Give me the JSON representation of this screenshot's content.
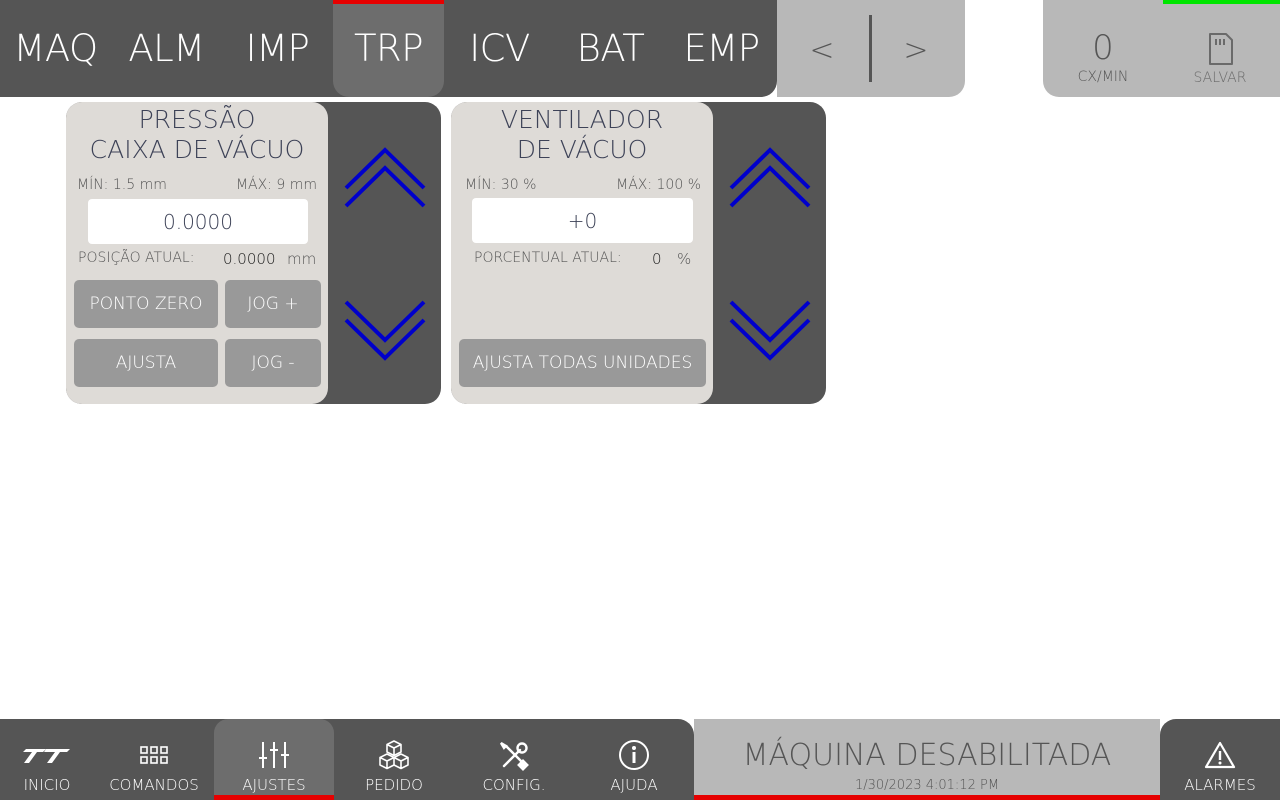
{
  "top_tabs": [
    {
      "label": "MAQ",
      "active": false
    },
    {
      "label": "ALM",
      "active": false
    },
    {
      "label": "IMP",
      "active": false
    },
    {
      "label": "TRP",
      "active": true
    },
    {
      "label": "ICV",
      "active": false
    },
    {
      "label": "BAT",
      "active": false
    },
    {
      "label": "EMP",
      "active": false
    }
  ],
  "pager": {
    "prev": "<",
    "next": ">"
  },
  "counter": {
    "value": "0",
    "label": "CX/MIN"
  },
  "save": {
    "label": "SALVAR",
    "icon": "sd-card-icon"
  },
  "panel_vacuum": {
    "title_line1": "PRESSÃO",
    "title_line2": "CAIXA DE VÁCUO",
    "min": "MÍN: 1.5 mm",
    "max": "MÁX: 9 mm",
    "value": "0.0000",
    "current_label": "POSIÇÃO ATUAL:",
    "current_value": "0.0000",
    "current_unit": "mm",
    "buttons": {
      "zero": "PONTO ZERO",
      "jog_plus": "JOG +",
      "adjust": "AJUSTA",
      "jog_minus": "JOG -"
    }
  },
  "panel_fan": {
    "title_line1": "VENTILADOR",
    "title_line2": "DE VÁCUO",
    "min": "MÍN: 30 %",
    "max": "MÁX: 100 %",
    "value": "+0",
    "current_label": "PORCENTUAL ATUAL:",
    "current_value": "0",
    "current_unit": "%",
    "buttons": {
      "adjust_all": "AJUSTA TODAS UNIDADES"
    }
  },
  "bottom_nav": [
    {
      "label": "INICIO",
      "icon": "logo-icon",
      "active": false
    },
    {
      "label": "COMANDOS",
      "icon": "grid-icon",
      "active": false
    },
    {
      "label": "AJUSTES",
      "icon": "sliders-icon",
      "active": true
    },
    {
      "label": "PEDIDO",
      "icon": "boxes-icon",
      "active": false
    },
    {
      "label": "CONFIG.",
      "icon": "tools-icon",
      "active": false
    },
    {
      "label": "AJUDA",
      "icon": "info-icon",
      "active": false
    }
  ],
  "machine_status": {
    "text": "MÁQUINA DESABILITADA",
    "datetime": "1/30/2023 4:01:12 PM"
  },
  "alarms": {
    "label": "ALARMES",
    "icon": "warning-icon"
  },
  "colors": {
    "dark": "#555555",
    "active_tab": "#6d6d6d",
    "light_panel": "#b8b8b8",
    "accent_red": "#e60000",
    "accent_green": "#00e600",
    "arrow_blue": "#0000cc",
    "panel_body": "#dedbd7"
  }
}
